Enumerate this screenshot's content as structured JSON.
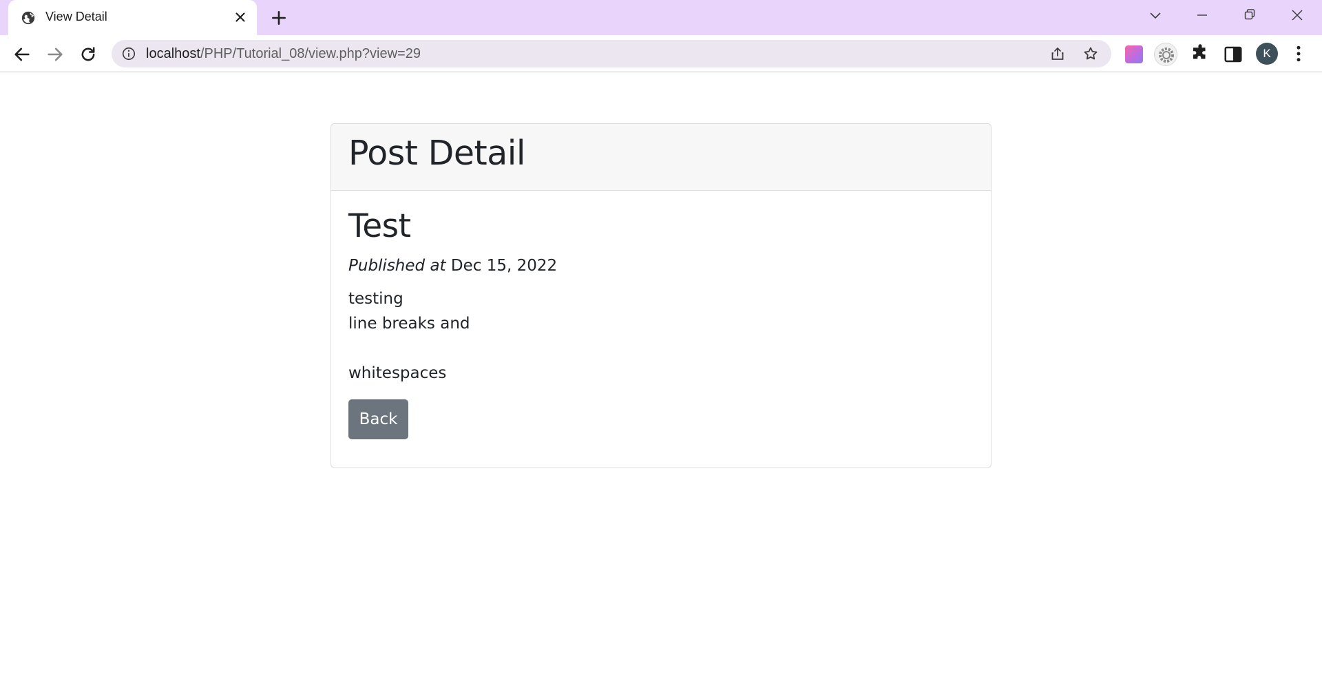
{
  "browser": {
    "tab_title": "View Detail",
    "url_host": "localhost",
    "url_path": "/PHP/Tutorial_08/view.php?view=29",
    "profile_initial": "K",
    "icons": {
      "favicon": "globe-icon",
      "tab_close": "close-icon",
      "new_tab": "plus-icon",
      "back": "arrow-left-icon",
      "forward": "arrow-right-icon",
      "reload": "reload-icon",
      "site_info": "info-icon",
      "share": "share-icon",
      "bookmark": "star-icon",
      "extensions": "puzzle-icon",
      "side_panel": "side-panel-icon",
      "menu": "kebab-menu-icon"
    },
    "colors": {
      "tabstrip": "#e9d5fb",
      "omnibox": "#ebe6f0"
    }
  },
  "page": {
    "header_title": "Post Detail",
    "post_title": "Test",
    "published_label": "Published at",
    "published_date": "Dec 15, 2022",
    "content_lines": [
      "testing",
      "line breaks and",
      "",
      "whitespaces"
    ],
    "back_label": "Back",
    "colors": {
      "button": "#6c757d",
      "header_bg": "#f7f7f7"
    }
  }
}
